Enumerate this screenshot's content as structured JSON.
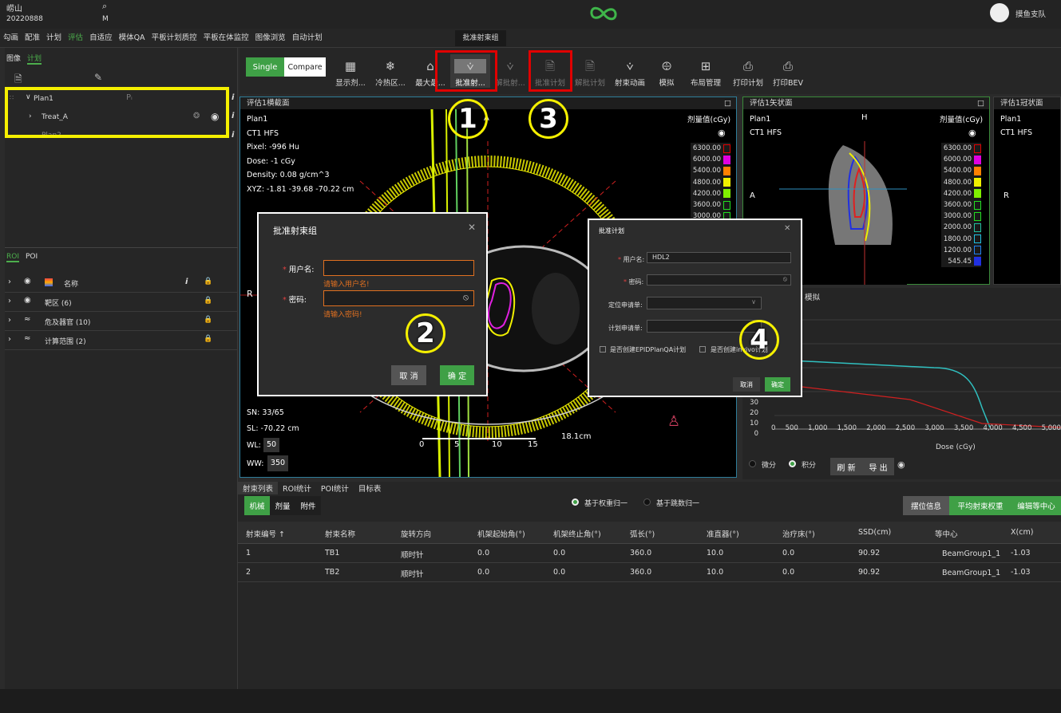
{
  "header": {
    "user_name": "崂山",
    "user_id": "20220888",
    "sex": "M",
    "logo": "infinity-logo-icon",
    "account": "摸鱼支队"
  },
  "menu": [
    "勾画",
    "配准",
    "计划",
    "评估",
    "自适应",
    "模体QA",
    "平板计划质控",
    "平板在体监控",
    "图像浏览",
    "自动计划"
  ],
  "menu_active": "评估",
  "left": {
    "tabs": [
      "图像",
      "计划"
    ],
    "tree": [
      {
        "label": "Plan1"
      },
      {
        "label": "Treat_A"
      },
      {
        "label": "Plan2"
      }
    ],
    "roi_tabs": [
      "ROI",
      "POI"
    ],
    "roi_header": "名称",
    "roi_rows": [
      "靶区 (6)",
      "危及器官 (10)",
      "计算范围 (2)"
    ]
  },
  "toolbar": {
    "single": "Single",
    "compare": "Compare",
    "tooltip": "批准射束组",
    "buttons": [
      {
        "label": "显示剂...",
        "icon": "grid-icon"
      },
      {
        "label": "冷热区...",
        "icon": "snowflake-sun-icon"
      },
      {
        "label": "最大最...",
        "icon": "peak-icon"
      },
      {
        "label": "批准射...",
        "icon": "approve-beam-icon"
      },
      {
        "label": "解批射...",
        "icon": "unapprove-beam-icon"
      },
      {
        "label": "批准计划",
        "icon": "approve-plan-icon"
      },
      {
        "label": "解批计划",
        "icon": "unapprove-plan-icon"
      },
      {
        "label": "射束动画",
        "icon": "beam-anim-icon"
      },
      {
        "label": "模拟",
        "icon": "simulate-icon"
      },
      {
        "label": "布局管理",
        "icon": "layout-icon"
      },
      {
        "label": "打印计划",
        "icon": "print-icon"
      },
      {
        "label": "打印BEV",
        "icon": "print-bev-icon"
      }
    ]
  },
  "view_axial": {
    "title": "评估1横截面",
    "info": [
      "Plan1",
      "CT1 HFS",
      "Pixel: -996 Hu",
      "Dose: -1 cGy",
      "Density: 0.08 g/cm^3",
      "XYZ: -1.81 -39.68 -70.22 cm"
    ],
    "legend_title": "剂量值(cGy)",
    "legend": [
      "6300.00",
      "6000.00",
      "5400.00",
      "4800.00",
      "4200.00",
      "3600.00",
      "3000.00"
    ],
    "bottom": [
      "SN: 33/65",
      "SL: -70.22 cm"
    ],
    "wl_label": "WL:",
    "wl": "50",
    "ww_label": "WW:",
    "ww": "350",
    "ruler": [
      "0",
      "5",
      "10",
      "15"
    ],
    "ruler_len": "18.1cm",
    "dir_a": "A",
    "dir_r": "R"
  },
  "view_sag": {
    "title": "评估1矢状面",
    "info": [
      "Plan1",
      "CT1 HFS"
    ],
    "legend_title": "剂量值(cGy)",
    "legend": [
      "6300.00",
      "6000.00",
      "5400.00",
      "4800.00",
      "4200.00",
      "3600.00",
      "3000.00",
      "2000.00",
      "1800.00",
      "1200.00",
      "545.45"
    ],
    "dir_h": "H",
    "dir_a": "A"
  },
  "view_cor": {
    "title": "评估1冠状面",
    "info": [
      "Plan1",
      "CT1 HFS"
    ],
    "dir_r": "R"
  },
  "dvh": {
    "title": "模拟",
    "xlabel": "Dose (cGy)",
    "xticks": [
      "0",
      "500",
      "1,000",
      "1,500",
      "2,000",
      "2,500",
      "3,000",
      "3,500",
      "4,000",
      "4,500",
      "5,000"
    ],
    "yticks": [
      "30",
      "20",
      "10",
      "0"
    ],
    "opt1": "微分",
    "opt2": "积分",
    "refresh": "刷 新",
    "export": "导 出"
  },
  "dialog1": {
    "title": "批准射束组",
    "user_label": "用户名:",
    "user_err": "请输入用户名!",
    "pwd_label": "密码:",
    "pwd_err": "请输入密码!",
    "cancel": "取 消",
    "ok": "确 定"
  },
  "dialog2": {
    "title": "批准计划",
    "user_label": "用户名:",
    "user_value": "HDL2",
    "pwd_label": "密码:",
    "loc_label": "定位申请单:",
    "plan_label": "计划申请单:",
    "cb1": "是否创建EPIDPlanQA计划",
    "cb2": "是否创建invivo计划",
    "cancel": "取消",
    "ok": "确定"
  },
  "callouts": [
    "1",
    "2",
    "3",
    "4"
  ],
  "bottom": {
    "tabs": [
      "射束列表",
      "ROI统计",
      "POI统计",
      "目标表"
    ],
    "subtabs": [
      "机械",
      "剂量",
      "附件"
    ],
    "radio1": "基于权重归一",
    "radio2": "基于跳数归一",
    "btns": [
      "摆位信息",
      "平均射束权重",
      "编辑等中心"
    ],
    "columns": [
      "射束编号 ↑",
      "射束名称",
      "旋转方向",
      "机架起始角(°)",
      "机架终止角(°)",
      "弧长(°)",
      "准直器(°)",
      "治疗床(°)",
      "SSD(cm)",
      "等中心",
      "X(cm)"
    ],
    "rows": [
      [
        "1",
        "TB1",
        "顺时针",
        "0.0",
        "0.0",
        "360.0",
        "10.0",
        "0.0",
        "90.92",
        "BeamGroup1_1",
        "-1.03"
      ],
      [
        "2",
        "TB2",
        "顺时针",
        "0.0",
        "0.0",
        "360.0",
        "10.0",
        "0.0",
        "90.92",
        "BeamGroup1_1",
        "-1.03"
      ]
    ]
  }
}
